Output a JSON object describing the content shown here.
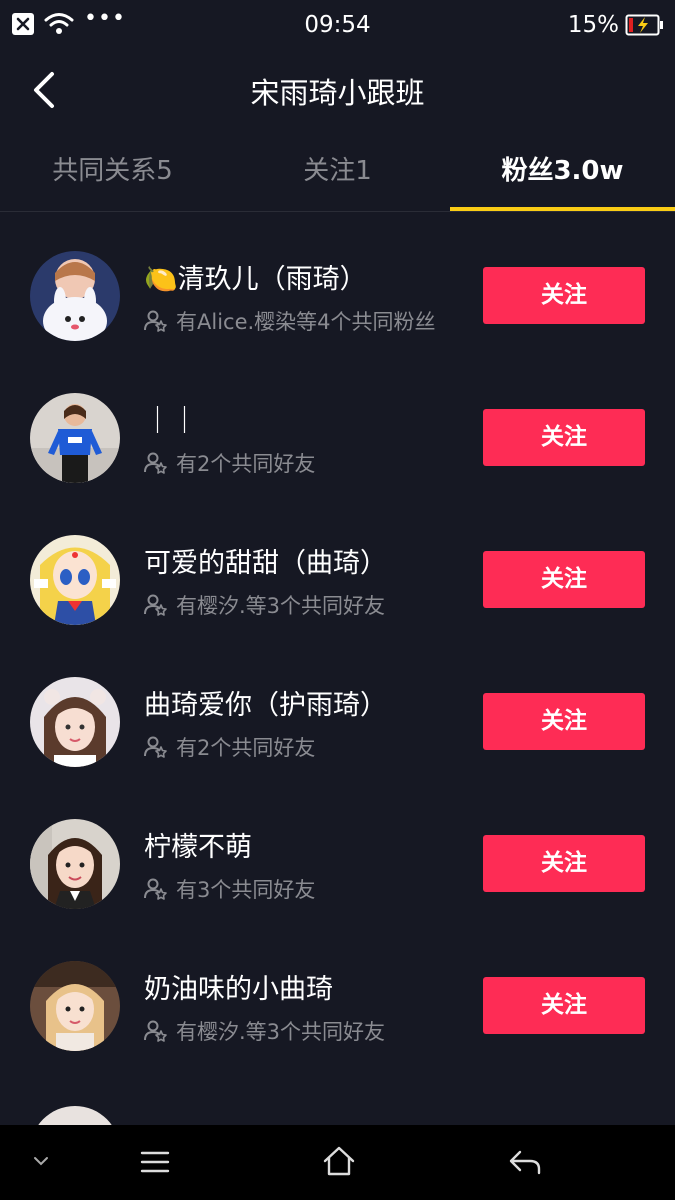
{
  "status": {
    "time": "09:54",
    "battery": "15%"
  },
  "header": {
    "title": "宋雨琦小跟班"
  },
  "tabs": [
    {
      "label": "共同关系5",
      "active": false
    },
    {
      "label": "关注1",
      "active": false
    },
    {
      "label": "粉丝3.0w",
      "active": true
    }
  ],
  "colors": {
    "background": "#161823",
    "accent": "#fe2c55",
    "tab_indicator": "#facc15",
    "secondary_text": "#8a8b91"
  },
  "users": [
    {
      "name": "🍋清玖儿（雨琦）",
      "mutual": "有Alice.樱染等4个共同粉丝",
      "follow_label": "关注",
      "avatar": "avatar-girl-bunny"
    },
    {
      "name": "｜｜",
      "mutual": "有2个共同好友",
      "follow_label": "关注",
      "avatar": "avatar-blue-shirt"
    },
    {
      "name": "可爱的甜甜（曲琦）",
      "mutual": "有樱汐.等3个共同好友",
      "follow_label": "关注",
      "avatar": "avatar-anime"
    },
    {
      "name": "曲琦爱你（护雨琦）",
      "mutual": "有2个共同好友",
      "follow_label": "关注",
      "avatar": "avatar-girl-bow"
    },
    {
      "name": "柠檬不萌",
      "mutual": "有3个共同好友",
      "follow_label": "关注",
      "avatar": "avatar-girl-smile"
    },
    {
      "name": "奶油味的小曲琦",
      "mutual": "有樱汐.等3个共同好友",
      "follow_label": "关注",
      "avatar": "avatar-girl-blonde"
    }
  ],
  "navbar": {
    "icons": [
      "chevron-down-icon",
      "menu-icon",
      "home-icon",
      "back-arrow-icon"
    ]
  }
}
